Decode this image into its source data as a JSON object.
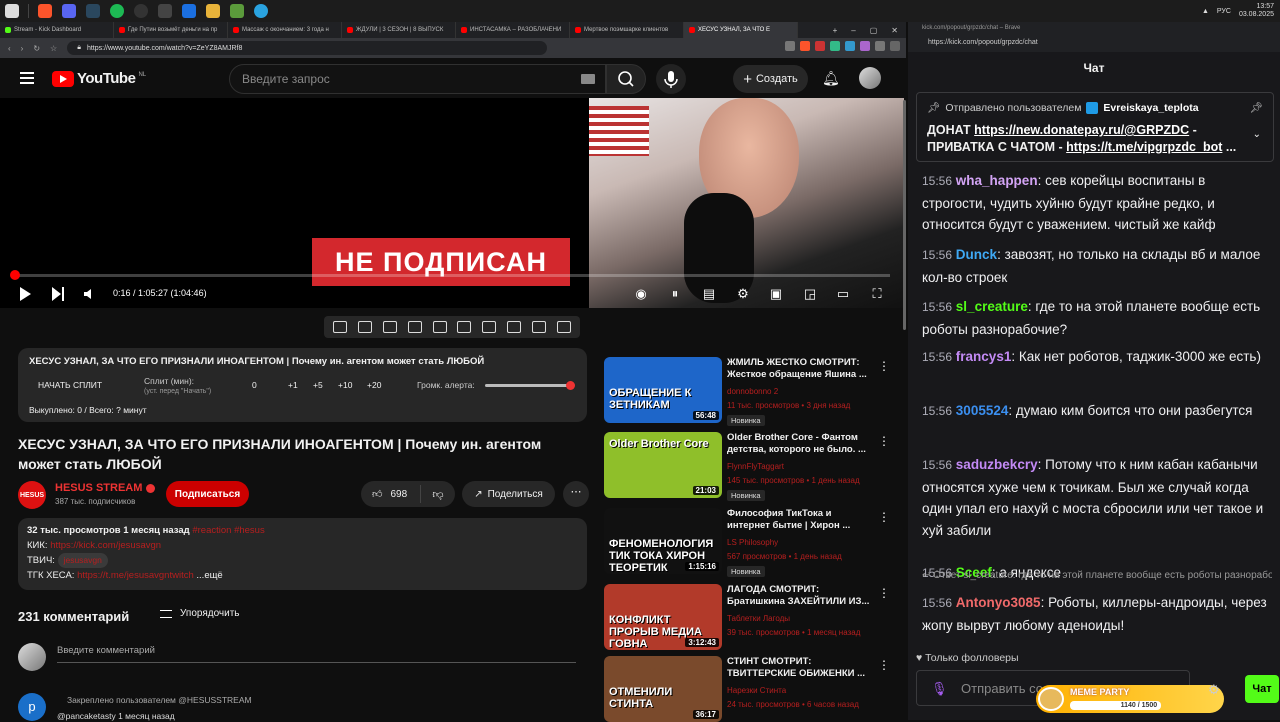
{
  "taskbar": {
    "clock_time": "13:57",
    "clock_date": "03.08.2025",
    "lang": "РУС"
  },
  "browser": {
    "tabs": [
      {
        "label": "Stream - Kick Dashboard",
        "color": "#53fc18"
      },
      {
        "label": "Где Путин возьмёт деньги на пр",
        "color": "#ff0000"
      },
      {
        "label": "Массаж с окончанием: 3 года н",
        "color": "#ff0000"
      },
      {
        "label": "ЖДУЛИ | 3 СЕЗОН | 8 ВЫПУСК",
        "color": "#ff0000"
      },
      {
        "label": "ИНСТАСАМКА – РАЗОБЛАЧЕНИ",
        "color": "#ff0000"
      },
      {
        "label": "Мертвое поэмшарке клиентов",
        "color": "#ff0000"
      },
      {
        "label": "ХЕСУС УЗНАЛ, ЗА ЧТО Е",
        "color": "#ff0000",
        "active": true
      }
    ],
    "url": "https://www.youtube.com/watch?v=ZeYZ8AMJRf8"
  },
  "youtube": {
    "logo": "YouTube",
    "region": "NL",
    "search_placeholder": "Введите запрос",
    "create_label": "Создать",
    "player": {
      "overlay_text": "НЕ ПОДПИСАН",
      "time": "0:16 / 1:05:27 (1:04:46)",
      "progress": 0.004
    },
    "split_panel": {
      "title": "ХЕСУС УЗНАЛ, ЗА ЧТО ЕГО ПРИЗНАЛИ ИНОАГЕНТОМ | Почему ин. агентом может стать ЛЮБОЙ",
      "start_label": "НАЧАТЬ СПЛИТ",
      "split_min_label": "Сплит (мин):",
      "split_sub": "(уст. перед \"Начать\")",
      "value": "0",
      "steps": [
        "+1",
        "+5",
        "+10",
        "+20"
      ],
      "alert_label": "Громк. алерта:",
      "alert_volume": 1.0,
      "done": "Выкуплено: 0 / Всего: ? минут"
    },
    "video": {
      "title": "ХЕСУС УЗНАЛ, ЗА ЧТО ЕГО ПРИЗНАЛИ ИНОАГЕНТОМ | Почему ин. агентом может стать ЛЮБОЙ",
      "channel_avatar_text": "HESUS",
      "channel": "HESUS STREAM",
      "subs": "387 тыс. подписчиков",
      "subscribe": "Подписаться",
      "likes": "698",
      "share": "Поделиться"
    },
    "description": {
      "views": "32 тыс. просмотров  1 месяц назад",
      "tags": "#reaction #hesus",
      "kick_label": "КИК:",
      "kick_link": "https://kick.com/jesusavgn",
      "twitch_label": "ТВИЧ:",
      "twitch_link": "jesusavgn",
      "tg_label": "ТГК ХЕСА:",
      "tg_link": "https://t.me/jesusavgntwitch",
      "more": "...ещё"
    },
    "comments": {
      "count": "231 комментарий",
      "sort": "Упорядочить",
      "placeholder": "Введите комментарий",
      "pinned": "Закреплено пользователем @HESUSSTREAM",
      "pinned_author": "@pancaketasty  1 месяц назад",
      "pinned_avatar": "p"
    },
    "recommendations": [
      {
        "title": "ЖМИЛЬ ЖЕСТКО СМОТРИТ: Жесткое обращение Яшина ...",
        "channel": "donnobonno 2",
        "meta": "11 тыс. просмотров  •  3 дня назад",
        "badge": "Новинка",
        "duration": "56:48",
        "thumb_text": "ОБРАЩЕНИЕ К ЗЕТНИКАМ",
        "thumb_color": "#1e66c9"
      },
      {
        "title": "Older Brother Core - Фантом детства, которого не было. ...",
        "channel": "FlynnFlyTaggart",
        "meta": "145 тыс. просмотров  •  1 день назад",
        "badge": "Новинка",
        "duration": "21:03",
        "thumb_text": "Older Brother Core",
        "thumb_color": "#8fbf2a"
      },
      {
        "title": "Философия ТикТока и интернет бытие | Хирон ...",
        "channel": "LS Philosophy",
        "meta": "567 просмотров  •  1 день назад",
        "badge": "Новинка",
        "duration": "1:15:16",
        "thumb_text": "ФЕНОМЕНОЛОГИЯ ТИК ТОКА ХИРОН ТЕОРЕТИК",
        "thumb_color": "#111111"
      },
      {
        "title": "ЛАГОДА СМОТРИТ: Братишкина ЗАХЕЙТИЛИ ИЗ...",
        "channel": "Таблетки Лагоды",
        "meta": "39 тыс. просмотров  •  1 месяц назад",
        "badge": "",
        "duration": "3:12:43",
        "thumb_text": "КОНФЛИКТ ПРОРЫВ МЕДИА ГОВНА",
        "thumb_color": "#b23a2a"
      },
      {
        "title": "СТИНТ СМОТРИТ: ТВИТТЕРСКИЕ ОБИЖЕНКИ ...",
        "channel": "Нарезки Стинта",
        "meta": "24 тыс. просмотров  •  6 часов назад",
        "badge": "",
        "duration": "36:17",
        "thumb_text": "ОТМЕНИЛИ СТИНТА",
        "thumb_color": "#7a4a2c"
      }
    ]
  },
  "chat": {
    "window_title": "kick.com/popout/grpzdc/chat – Brave",
    "url": "https://kick.com/popout/grpzdc/chat",
    "header": "Чат",
    "pinned_by_label": "Отправлено пользователем",
    "pinned_by": "Evreiskaya_teplota",
    "pinned_text_1": "ДОНАТ ",
    "pinned_link_1": "https://new.donatepay.ru/@GRPZDC",
    "pinned_text_2": " - ПРИВАТКА С ЧАТОМ - ",
    "pinned_link_2": "https://t.me/vipgrpzdc_bot",
    "pinned_tail": " ...",
    "messages": [
      {
        "time": "15:56",
        "user": "wha_happen",
        "color": "#d3a4f5",
        "text": "сев корейцы воспитаны в строгости, чудить хуйню будут крайне редко, и относится будут с уважением. чистый же кайф"
      },
      {
        "time": "15:56",
        "user": "Dunck",
        "color": "#3fa9f5",
        "text": "завозят, но только на склады вб и малое кол-во строек"
      },
      {
        "time": "15:56",
        "user": "sl_creature",
        "color": "#53fc18",
        "text": "где то на этой планете вообще есть роботы разнорабочие?"
      },
      {
        "time": "15:56",
        "user": "francys1",
        "color": "#c38af5",
        "text": "Как нет роботов, таджик-3000 же есть)"
      },
      {
        "time": "15:56",
        "user": "3005524",
        "color": "#3b8ff0",
        "text": "думаю ким боится что они разбегутся"
      },
      {
        "time": "15:56",
        "user": "saduzbekcry",
        "color": "#c38af5",
        "text": "Потому что к ним кабан кабанычи относятся хуже чем к точикам. Был же случай когда один упал его нахуй с моста сбросили или чет такое и хуй забили"
      },
      {
        "time": "15:56",
        "user": "Sceef",
        "color": "#53fc18",
        "text": "а яндексе"
      },
      {
        "time": "15:56",
        "user": "Antonyo3085",
        "color": "#f06a6a",
        "text": "Роботы, киллеры-андроиды, через жопу вырвут любому аденоиды!"
      }
    ],
    "reply_hint": "Ответ sl_creature: где то на этой планете вообще есть роботы разнорабочие?",
    "followers_only": "Только фолловеры",
    "input_placeholder": "Отправить со",
    "send": "Чат",
    "meme_party": "MEME PARTY",
    "meme_progress": "1140 / 1500",
    "meme_fraction": 0.76
  }
}
